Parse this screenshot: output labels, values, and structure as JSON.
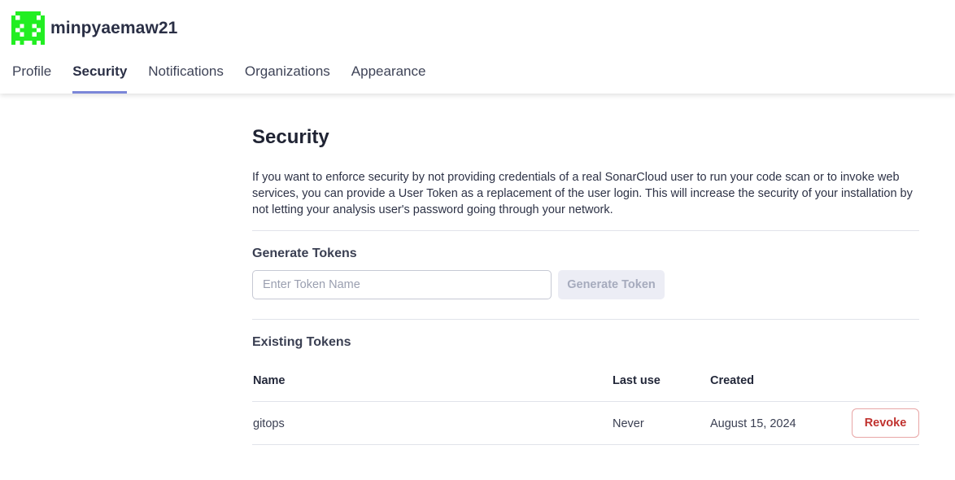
{
  "header": {
    "username": "minpyaemaw21",
    "avatar_color": "#22ee22"
  },
  "tabs": [
    {
      "label": "Profile",
      "active": false
    },
    {
      "label": "Security",
      "active": true
    },
    {
      "label": "Notifications",
      "active": false
    },
    {
      "label": "Organizations",
      "active": false
    },
    {
      "label": "Appearance",
      "active": false
    }
  ],
  "security": {
    "title": "Security",
    "description": "If you want to enforce security by not providing credentials of a real SonarCloud user to run your code scan or to invoke web services, you can provide a User Token as a replacement of the user login. This will increase the security of your installation by not letting your analysis user's password going through your network.",
    "generate": {
      "section_title": "Generate Tokens",
      "input_placeholder": "Enter Token Name",
      "input_value": "",
      "button_label": "Generate Token"
    },
    "existing": {
      "section_title": "Existing Tokens",
      "columns": {
        "name": "Name",
        "last_use": "Last use",
        "created": "Created"
      },
      "rows": [
        {
          "name": "gitops",
          "last_use": "Never",
          "created": "August 15, 2024",
          "action": "Revoke"
        }
      ]
    }
  },
  "colors": {
    "active_tab_underline": "#7b86d8",
    "revoke_text": "#c0322f",
    "revoke_border": "#e8a6a6",
    "disabled_button_bg": "#ecedf5"
  }
}
